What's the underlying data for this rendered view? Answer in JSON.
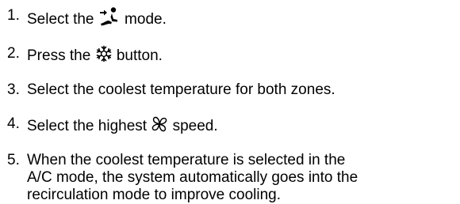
{
  "instructions": {
    "steps": [
      {
        "number": "1.",
        "before": "Select the ",
        "icon": "vent-mode-icon",
        "after": " mode."
      },
      {
        "number": "2.",
        "before": "Press the ",
        "icon": "ac-button-icon",
        "after": " button."
      },
      {
        "number": "3.",
        "text": "Select the coolest temperature for both zones."
      },
      {
        "number": "4.",
        "before": "Select the highest ",
        "icon": "fan-icon",
        "after": " speed."
      },
      {
        "number": "5.",
        "lines": [
          "When the coolest temperature is selected in the",
          "A/C mode, the system automatically goes into the",
          "recirculation mode to improve cooling."
        ]
      }
    ]
  }
}
